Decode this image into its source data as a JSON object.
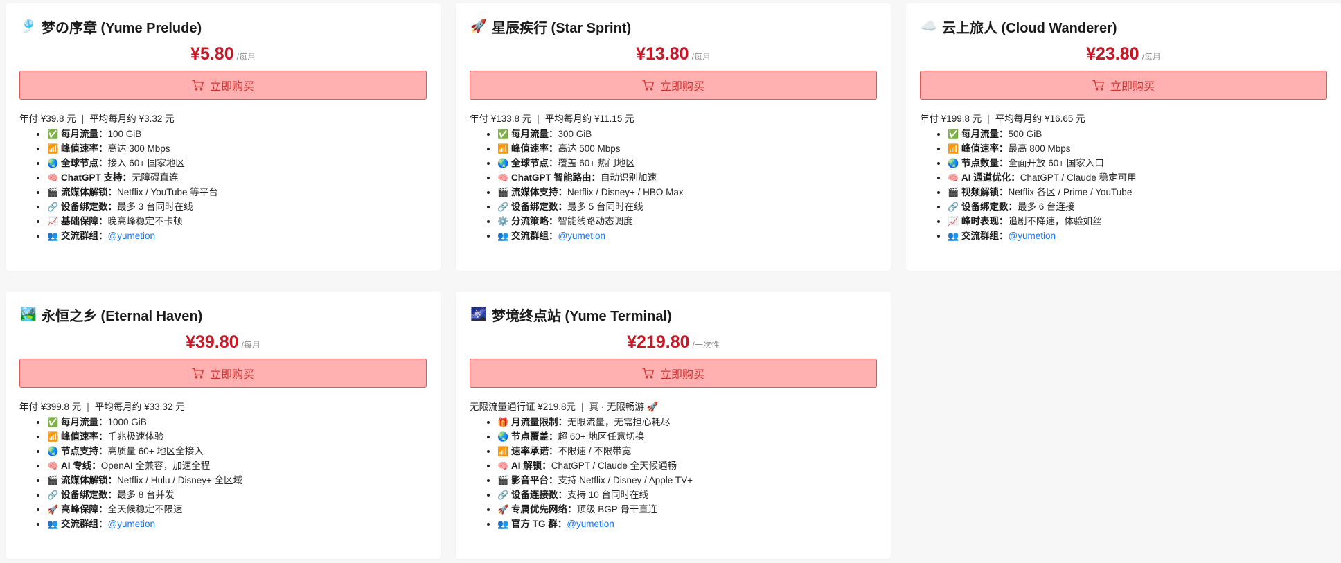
{
  "colors": {
    "price": "#cf1322",
    "button_bg": "#ffb1b1",
    "button_border": "#e55454",
    "button_text": "#d23636",
    "link": "#1677ff"
  },
  "buy_label": "立即购买",
  "plans": [
    {
      "icon": "🎐",
      "icon_name": "wind-chime-icon",
      "name": "梦の序章 (Yume Prelude)",
      "price": "¥5.80",
      "period": "/每月",
      "summary_a": "年付 ¥39.8 元",
      "summary_sep": "|",
      "summary_b": "平均每月约 ¥3.32 元",
      "features": [
        {
          "icon": "✅",
          "label": "每月流量：",
          "value": "100 GiB"
        },
        {
          "icon": "📶",
          "label": "峰值速率：",
          "value": "高达 300 Mbps"
        },
        {
          "icon": "🌏",
          "label": "全球节点：",
          "value": "接入 60+ 国家地区"
        },
        {
          "icon": "🧠",
          "label": "ChatGPT 支持：",
          "value": "无障碍直连"
        },
        {
          "icon": "🎬",
          "label": "流媒体解锁：",
          "value": "Netflix / YouTube 等平台"
        },
        {
          "icon": "🔗",
          "label": "设备绑定数：",
          "value": "最多 3 台同时在线"
        },
        {
          "icon": "📈",
          "label": "基础保障：",
          "value": "晚高峰稳定不卡顿"
        },
        {
          "icon": "👥",
          "label": "交流群组：",
          "value": "@yumetion",
          "link": true
        }
      ]
    },
    {
      "icon": "🚀",
      "icon_name": "rocket-icon",
      "name": "星辰疾行 (Star Sprint)",
      "price": "¥13.80",
      "period": "/每月",
      "summary_a": "年付 ¥133.8 元",
      "summary_sep": "|",
      "summary_b": "平均每月约 ¥11.15 元",
      "features": [
        {
          "icon": "✅",
          "label": "每月流量：",
          "value": "300 GiB"
        },
        {
          "icon": "📶",
          "label": "峰值速率：",
          "value": "高达 500 Mbps"
        },
        {
          "icon": "🌏",
          "label": "全球节点：",
          "value": "覆盖 60+ 热门地区"
        },
        {
          "icon": "🧠",
          "label": "ChatGPT 智能路由：",
          "value": "自动识别加速"
        },
        {
          "icon": "🎬",
          "label": "流媒体支持：",
          "value": "Netflix / Disney+ / HBO Max"
        },
        {
          "icon": "🔗",
          "label": "设备绑定数：",
          "value": "最多 5 台同时在线"
        },
        {
          "icon": "⚙️",
          "label": "分流策略：",
          "value": "智能线路动态调度"
        },
        {
          "icon": "👥",
          "label": "交流群组：",
          "value": "@yumetion",
          "link": true
        }
      ]
    },
    {
      "icon": "☁️",
      "icon_name": "cloud-icon",
      "name": "云上旅人 (Cloud Wanderer)",
      "price": "¥23.80",
      "period": "/每月",
      "summary_a": "年付 ¥199.8 元",
      "summary_sep": "|",
      "summary_b": "平均每月约 ¥16.65 元",
      "features": [
        {
          "icon": "✅",
          "label": "每月流量：",
          "value": "500 GiB"
        },
        {
          "icon": "📶",
          "label": "峰值速率：",
          "value": "最高 800 Mbps"
        },
        {
          "icon": "🌏",
          "label": "节点数量：",
          "value": "全面开放 60+ 国家入口"
        },
        {
          "icon": "🧠",
          "label": "AI 通道优化：",
          "value": "ChatGPT / Claude 稳定可用"
        },
        {
          "icon": "🎬",
          "label": "视频解锁：",
          "value": "Netflix 各区 / Prime / YouTube"
        },
        {
          "icon": "🔗",
          "label": "设备绑定数：",
          "value": "最多 6 台连接"
        },
        {
          "icon": "📈",
          "label": "峰时表现：",
          "value": "追剧不降速，体验如丝"
        },
        {
          "icon": "👥",
          "label": "交流群组：",
          "value": "@yumetion",
          "link": true
        }
      ]
    },
    {
      "icon": "🏞️",
      "icon_name": "landscape-icon",
      "name": "永恒之乡 (Eternal Haven)",
      "price": "¥39.80",
      "period": "/每月",
      "summary_a": "年付 ¥399.8 元",
      "summary_sep": "|",
      "summary_b": "平均每月约 ¥33.32 元",
      "features": [
        {
          "icon": "✅",
          "label": "每月流量：",
          "value": "1000 GiB"
        },
        {
          "icon": "📶",
          "label": "峰值速率：",
          "value": "千兆极速体验"
        },
        {
          "icon": "🌏",
          "label": "节点支持：",
          "value": "高质量 60+ 地区全接入"
        },
        {
          "icon": "🧠",
          "label": "AI 专线：",
          "value": "OpenAI 全兼容，加速全程"
        },
        {
          "icon": "🎬",
          "label": "流媒体解锁：",
          "value": "Netflix / Hulu / Disney+ 全区域"
        },
        {
          "icon": "🔗",
          "label": "设备绑定数：",
          "value": "最多 8 台并发"
        },
        {
          "icon": "🚀",
          "label": "高峰保障：",
          "value": "全天候稳定不限速"
        },
        {
          "icon": "👥",
          "label": "交流群组：",
          "value": "@yumetion",
          "link": true
        }
      ]
    },
    {
      "icon": "🌌",
      "icon_name": "milky-way-icon",
      "name": "梦境终点站 (Yume Terminal)",
      "price": "¥219.80",
      "period": "/一次性",
      "summary_a": "无限流量通行证 ¥219.8元",
      "summary_sep": "|",
      "summary_b": "真 · 无限畅游 🚀",
      "features": [
        {
          "icon": "🎁",
          "label": "月流量限制：",
          "value": "无限流量，无需担心耗尽"
        },
        {
          "icon": "🌏",
          "label": "节点覆盖：",
          "value": "超 60+ 地区任意切换"
        },
        {
          "icon": "📶",
          "label": "速率承诺：",
          "value": "不限速 / 不限带宽"
        },
        {
          "icon": "🧠",
          "label": "AI 解锁：",
          "value": "ChatGPT / Claude 全天候通畅"
        },
        {
          "icon": "🎬",
          "label": "影音平台：",
          "value": "支持 Netflix / Disney / Apple TV+"
        },
        {
          "icon": "🔗",
          "label": "设备连接数：",
          "value": "支持 10 台同时在线"
        },
        {
          "icon": "🚀",
          "label": "专属优先网络：",
          "value": "顶级 BGP 骨干直连"
        },
        {
          "icon": "👥",
          "label": "官方 TG 群：",
          "value": "@yumetion",
          "link": true
        }
      ]
    }
  ]
}
